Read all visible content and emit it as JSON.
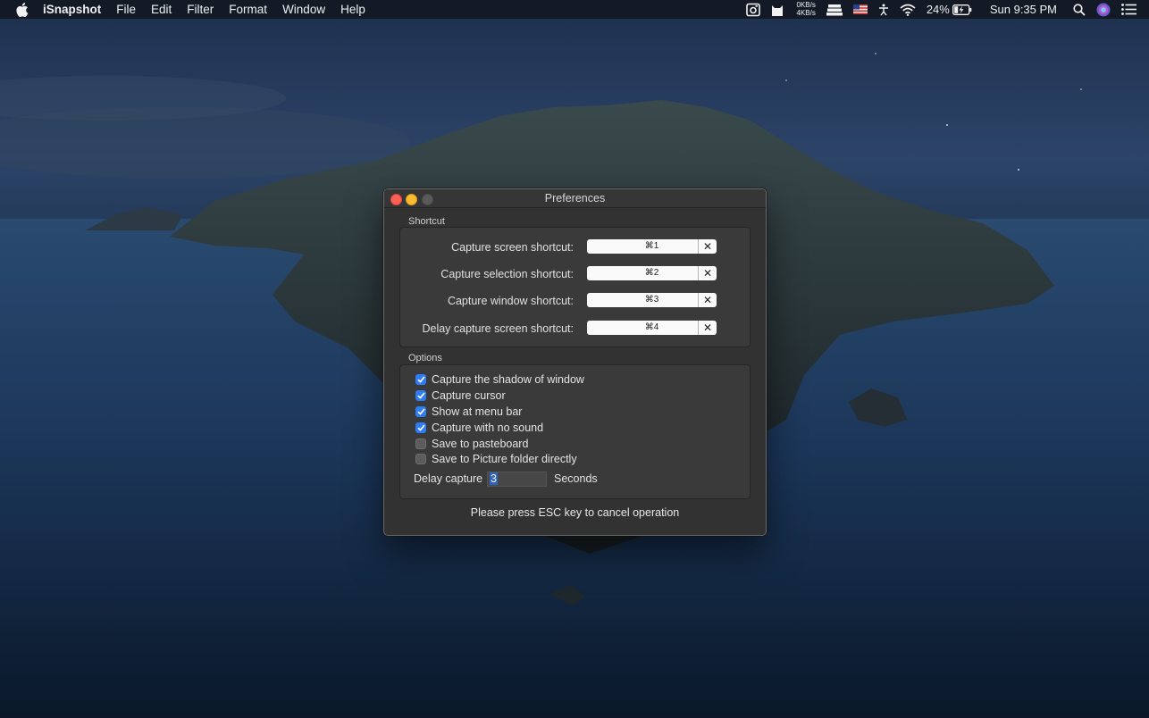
{
  "menubar": {
    "app_name": "iSnapshot",
    "items": [
      "File",
      "Edit",
      "Filter",
      "Format",
      "Window",
      "Help"
    ],
    "status": {
      "net_up": "0KB/s",
      "net_down": "4KB/s",
      "battery": "24%",
      "clock": "Sun 9:35 PM"
    }
  },
  "window": {
    "title": "Preferences",
    "shortcut_section": {
      "label": "Shortcut",
      "rows": [
        {
          "label": "Capture screen shortcut:",
          "value": "⌘1"
        },
        {
          "label": "Capture selection shortcut:",
          "value": "⌘2"
        },
        {
          "label": "Capture window shortcut:",
          "value": "⌘3"
        },
        {
          "label": "Delay capture screen shortcut:",
          "value": "⌘4"
        }
      ],
      "clear_glyph": "✕"
    },
    "options_section": {
      "label": "Options",
      "items": [
        {
          "label": "Capture the shadow of window",
          "checked": true
        },
        {
          "label": "Capture cursor",
          "checked": true
        },
        {
          "label": "Show at menu bar",
          "checked": true
        },
        {
          "label": "Capture with no sound",
          "checked": true
        },
        {
          "label": "Save to pasteboard",
          "checked": false
        },
        {
          "label": "Save to Picture folder directly",
          "checked": false
        }
      ],
      "delay_label": "Delay capture",
      "delay_value": "3",
      "delay_unit": "Seconds"
    },
    "footer": "Please press ESC key to cancel operation"
  },
  "colors": {
    "accent": "#2e7cf6",
    "close": "#fe5f57",
    "minimize": "#febb2e"
  }
}
